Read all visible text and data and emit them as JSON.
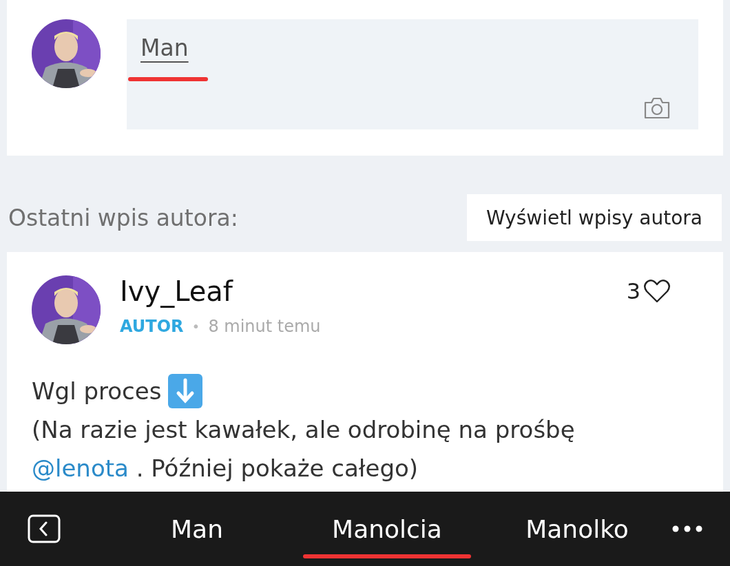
{
  "comment_box": {
    "value": "Man",
    "annotated": true
  },
  "latest_post_section": {
    "title": "Ostatni wpis autora:",
    "button": "Wyświetl wpisy autora"
  },
  "post": {
    "author": "Ivy_Leaf",
    "badge": "AUTOR",
    "separator": "•",
    "time": "8 minut temu",
    "likes": "3",
    "body": [
      {
        "kind": "emoji",
        "text": "Wgl proces"
      },
      {
        "kind": "plain",
        "text": "(Na razie jest kawałek, ale odrobinę na prośbę"
      },
      {
        "kind": "mention",
        "mention": "@lenota",
        "text": ". Później pokaże całego)"
      }
    ]
  },
  "keyboard_suggestions": [
    {
      "label": "Man",
      "annotated": false
    },
    {
      "label": "Manolcia",
      "annotated": true
    },
    {
      "label": "Manolko",
      "annotated": false
    }
  ]
}
